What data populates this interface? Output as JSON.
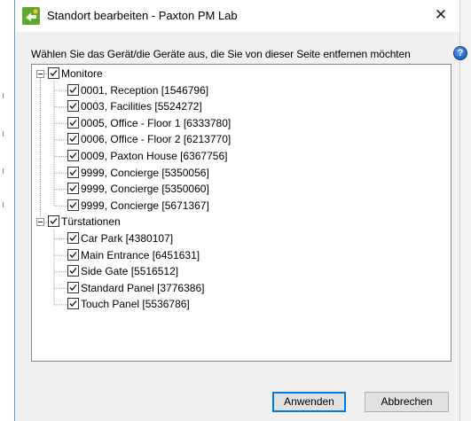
{
  "window": {
    "title": "Standort bearbeiten - Paxton PM Lab",
    "close_glyph": "✕",
    "icon": "paxton-app-icon"
  },
  "instruction": "Wählen Sie das Gerät/die Geräte aus, die Sie von dieser Seite entfernen möchten",
  "help_glyph": "?",
  "tree": {
    "groups": [
      {
        "label": "Monitore",
        "expanded": true,
        "checked": true,
        "items": [
          {
            "label": "0001, Reception [1546796]",
            "checked": true
          },
          {
            "label": "0003, Facilities [5524272]",
            "checked": true
          },
          {
            "label": "0005, Office - Floor 1 [6333780]",
            "checked": true
          },
          {
            "label": "0006, Office - Floor 2 [6213770]",
            "checked": true
          },
          {
            "label": "0009, Paxton House [6367756]",
            "checked": true
          },
          {
            "label": "9999, Concierge [5350056]",
            "checked": true
          },
          {
            "label": "9999, Concierge [5350060]",
            "checked": true
          },
          {
            "label": "9999, Concierge [5671367]",
            "checked": true
          }
        ]
      },
      {
        "label": "Türstationen",
        "expanded": true,
        "checked": true,
        "items": [
          {
            "label": "Car Park [4380107]",
            "checked": true
          },
          {
            "label": "Main Entrance [6451631]",
            "checked": true
          },
          {
            "label": "Side Gate [5516512]",
            "checked": true
          },
          {
            "label": "Standard Panel [3776386]",
            "checked": true
          },
          {
            "label": "Touch Panel [5536786]",
            "checked": true
          }
        ]
      }
    ]
  },
  "buttons": {
    "apply": "Anwenden",
    "cancel": "Abbrechen"
  },
  "colors": {
    "accent": "#0078d7",
    "dialog_bg": "#f0f0f0",
    "icon_green": "#5fa82a"
  }
}
